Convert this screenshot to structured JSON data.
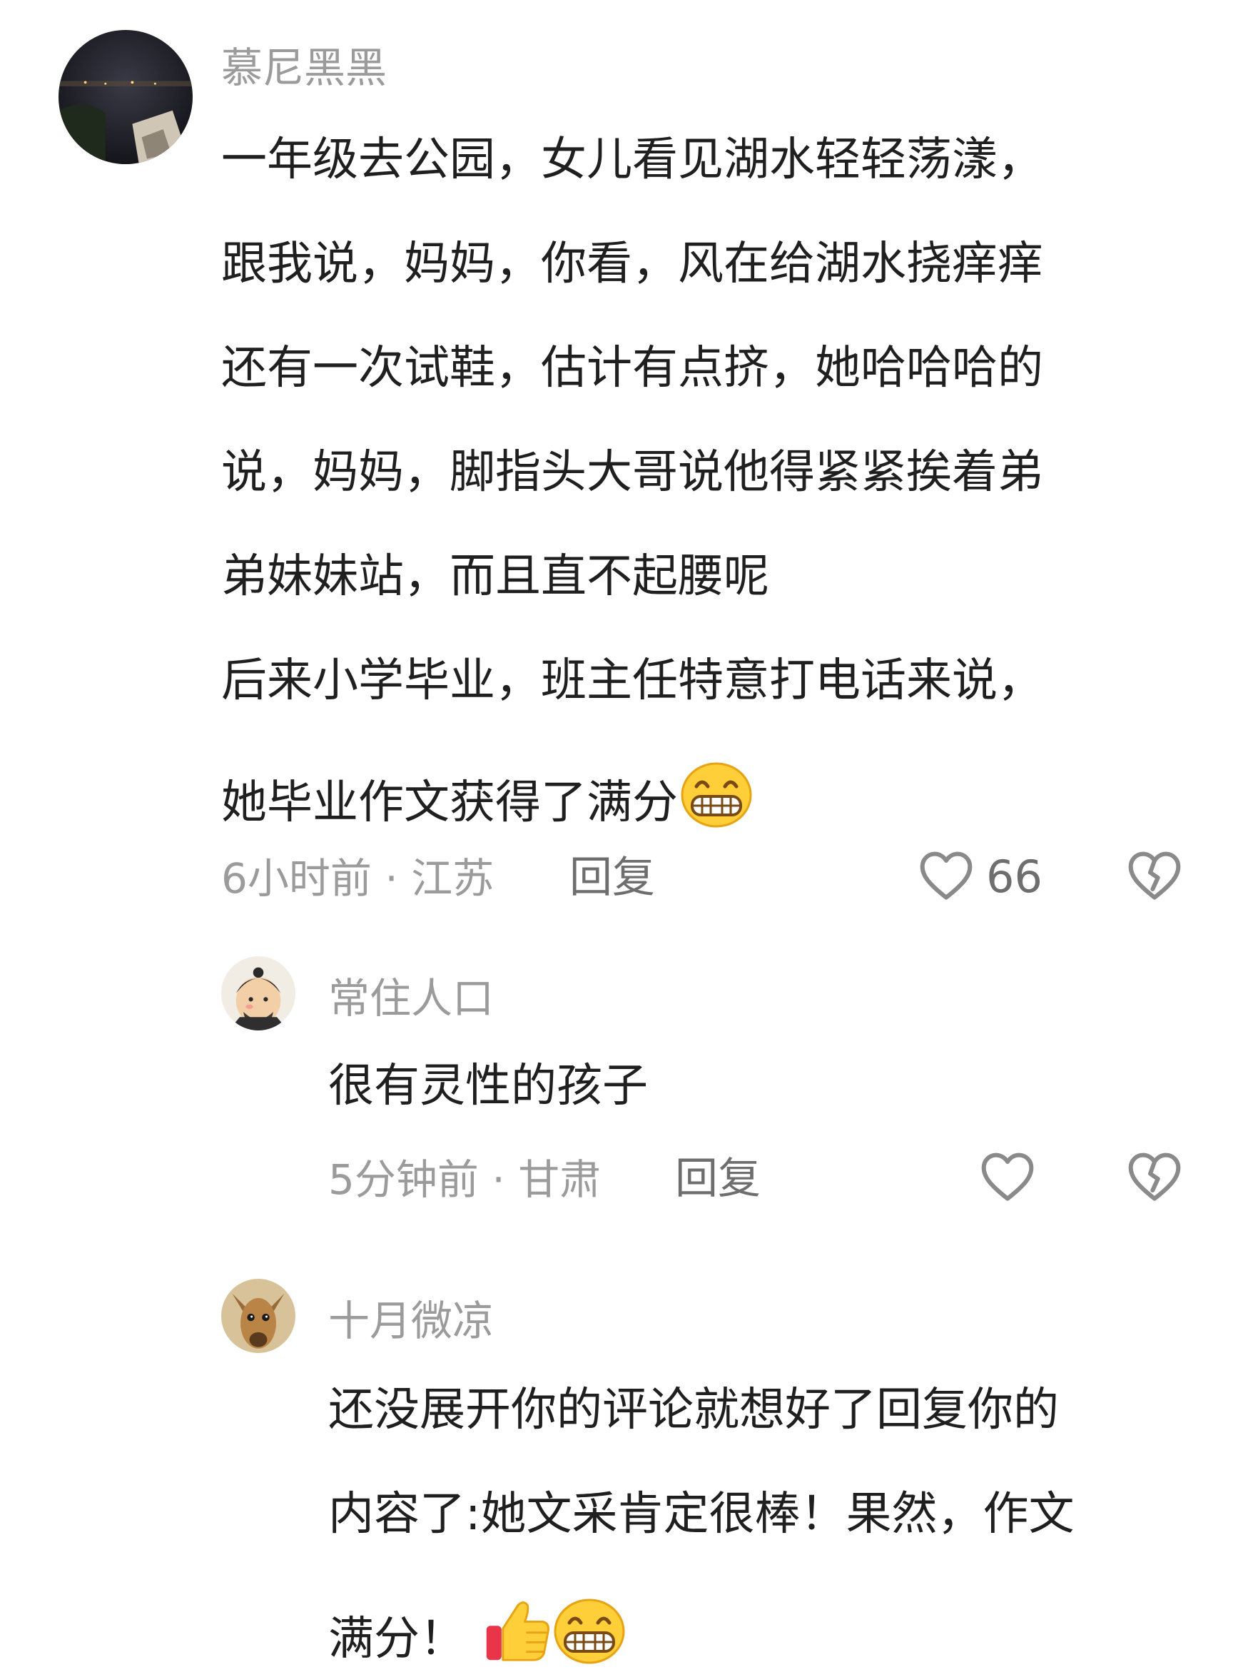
{
  "comments": [
    {
      "username": "慕尼黑黑",
      "avatar": "night-city-avatar",
      "lines": [
        "一年级去公园，女儿看见湖水轻轻荡漾，",
        "跟我说，妈妈，你看，风在给湖水挠痒痒",
        "还有一次试鞋，估计有点挤，她哈哈哈的",
        "说，妈妈，脚指头大哥说他得紧紧挨着弟",
        "弟妹妹站，而且直不起腰呢",
        "后来小学毕业，班主任特意打电话来说，",
        "她毕业作文获得了满分"
      ],
      "end_emoji": "grin-emoji",
      "meta": "6小时前 · 江苏",
      "reply_label": "回复",
      "like_count": "66"
    },
    {
      "username": "常住人口",
      "avatar": "cartoon-man-avatar",
      "lines": [
        "很有灵性的孩子"
      ],
      "meta": "5分钟前 · 甘肃",
      "reply_label": "回复"
    },
    {
      "username": "十月微凉",
      "avatar": "deer-avatar",
      "lines": [
        "还没展开你的评论就想好了回复你的",
        "内容了:她文采肯定很棒！果然，作文",
        "满分！"
      ],
      "end_emoji": [
        "thumbs-up-emoji",
        "grin-emoji"
      ]
    }
  ],
  "colors": {
    "text": "#1f1f1f",
    "muted": "#9b9b9b",
    "reply": "#6e6e6e",
    "icon": "#8a8a8a"
  }
}
